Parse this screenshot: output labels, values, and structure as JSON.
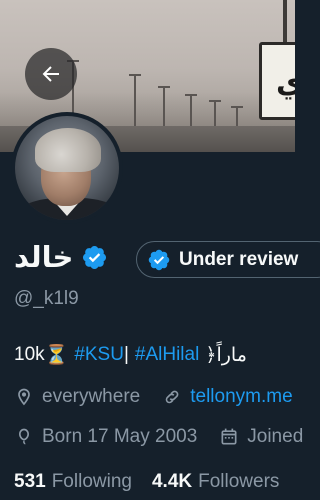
{
  "header": {
    "back_icon": "arrow-left-icon"
  },
  "banner": {
    "sign_text": "ي"
  },
  "profile": {
    "display_name": "خالد",
    "verified_icon": "verified-badge-icon",
    "handle": "@_k1l9",
    "review_button_label": "Under review",
    "bio": {
      "prefix": "10k",
      "hourglass": "⏳",
      "tag1": "#KSU",
      "separator": "|",
      "tag2": "#AlHilal",
      "suffix": "﴿ماراً"
    },
    "location": "everywhere",
    "website": "tellonym.me",
    "birthday": "Born 17 May 2003",
    "joined": "Joined",
    "following_count": "531",
    "following_label": "Following",
    "followers_count": "4.4K",
    "followers_label": "Followers"
  },
  "colors": {
    "background": "#15202b",
    "accent": "#1d9bf0",
    "secondary_text": "#8b98a5"
  }
}
